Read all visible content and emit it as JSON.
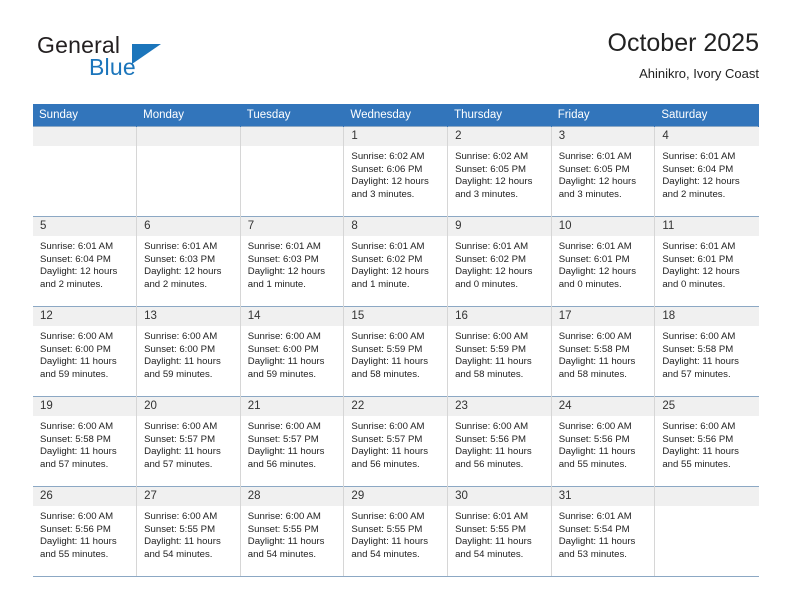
{
  "brand": {
    "word_one": "General",
    "word_two": "Blue",
    "triangle_icon": "triangle-logo-icon",
    "color_primary": "#1b75bb",
    "color_text": "#231f20"
  },
  "header": {
    "title": "October 2025",
    "subtitle": "Ahinikro, Ivory Coast"
  },
  "calendar": {
    "header_background": "#3275bb",
    "daynum_background": "#f0f0f0",
    "weekday_headers": [
      "Sunday",
      "Monday",
      "Tuesday",
      "Wednesday",
      "Thursday",
      "Friday",
      "Saturday"
    ],
    "weeks": [
      [
        {
          "day": "",
          "empty": true,
          "sunrise": "",
          "sunset": "",
          "daylight_1": "",
          "daylight_2": ""
        },
        {
          "day": "",
          "empty": true,
          "sunrise": "",
          "sunset": "",
          "daylight_1": "",
          "daylight_2": ""
        },
        {
          "day": "",
          "empty": true,
          "sunrise": "",
          "sunset": "",
          "daylight_1": "",
          "daylight_2": ""
        },
        {
          "day": "1",
          "empty": false,
          "sunrise": "Sunrise: 6:02 AM",
          "sunset": "Sunset: 6:06 PM",
          "daylight_1": "Daylight: 12 hours",
          "daylight_2": "and 3 minutes."
        },
        {
          "day": "2",
          "empty": false,
          "sunrise": "Sunrise: 6:02 AM",
          "sunset": "Sunset: 6:05 PM",
          "daylight_1": "Daylight: 12 hours",
          "daylight_2": "and 3 minutes."
        },
        {
          "day": "3",
          "empty": false,
          "sunrise": "Sunrise: 6:01 AM",
          "sunset": "Sunset: 6:05 PM",
          "daylight_1": "Daylight: 12 hours",
          "daylight_2": "and 3 minutes."
        },
        {
          "day": "4",
          "empty": false,
          "sunrise": "Sunrise: 6:01 AM",
          "sunset": "Sunset: 6:04 PM",
          "daylight_1": "Daylight: 12 hours",
          "daylight_2": "and 2 minutes."
        }
      ],
      [
        {
          "day": "5",
          "empty": false,
          "sunrise": "Sunrise: 6:01 AM",
          "sunset": "Sunset: 6:04 PM",
          "daylight_1": "Daylight: 12 hours",
          "daylight_2": "and 2 minutes."
        },
        {
          "day": "6",
          "empty": false,
          "sunrise": "Sunrise: 6:01 AM",
          "sunset": "Sunset: 6:03 PM",
          "daylight_1": "Daylight: 12 hours",
          "daylight_2": "and 2 minutes."
        },
        {
          "day": "7",
          "empty": false,
          "sunrise": "Sunrise: 6:01 AM",
          "sunset": "Sunset: 6:03 PM",
          "daylight_1": "Daylight: 12 hours",
          "daylight_2": "and 1 minute."
        },
        {
          "day": "8",
          "empty": false,
          "sunrise": "Sunrise: 6:01 AM",
          "sunset": "Sunset: 6:02 PM",
          "daylight_1": "Daylight: 12 hours",
          "daylight_2": "and 1 minute."
        },
        {
          "day": "9",
          "empty": false,
          "sunrise": "Sunrise: 6:01 AM",
          "sunset": "Sunset: 6:02 PM",
          "daylight_1": "Daylight: 12 hours",
          "daylight_2": "and 0 minutes."
        },
        {
          "day": "10",
          "empty": false,
          "sunrise": "Sunrise: 6:01 AM",
          "sunset": "Sunset: 6:01 PM",
          "daylight_1": "Daylight: 12 hours",
          "daylight_2": "and 0 minutes."
        },
        {
          "day": "11",
          "empty": false,
          "sunrise": "Sunrise: 6:01 AM",
          "sunset": "Sunset: 6:01 PM",
          "daylight_1": "Daylight: 12 hours",
          "daylight_2": "and 0 minutes."
        }
      ],
      [
        {
          "day": "12",
          "empty": false,
          "sunrise": "Sunrise: 6:00 AM",
          "sunset": "Sunset: 6:00 PM",
          "daylight_1": "Daylight: 11 hours",
          "daylight_2": "and 59 minutes."
        },
        {
          "day": "13",
          "empty": false,
          "sunrise": "Sunrise: 6:00 AM",
          "sunset": "Sunset: 6:00 PM",
          "daylight_1": "Daylight: 11 hours",
          "daylight_2": "and 59 minutes."
        },
        {
          "day": "14",
          "empty": false,
          "sunrise": "Sunrise: 6:00 AM",
          "sunset": "Sunset: 6:00 PM",
          "daylight_1": "Daylight: 11 hours",
          "daylight_2": "and 59 minutes."
        },
        {
          "day": "15",
          "empty": false,
          "sunrise": "Sunrise: 6:00 AM",
          "sunset": "Sunset: 5:59 PM",
          "daylight_1": "Daylight: 11 hours",
          "daylight_2": "and 58 minutes."
        },
        {
          "day": "16",
          "empty": false,
          "sunrise": "Sunrise: 6:00 AM",
          "sunset": "Sunset: 5:59 PM",
          "daylight_1": "Daylight: 11 hours",
          "daylight_2": "and 58 minutes."
        },
        {
          "day": "17",
          "empty": false,
          "sunrise": "Sunrise: 6:00 AM",
          "sunset": "Sunset: 5:58 PM",
          "daylight_1": "Daylight: 11 hours",
          "daylight_2": "and 58 minutes."
        },
        {
          "day": "18",
          "empty": false,
          "sunrise": "Sunrise: 6:00 AM",
          "sunset": "Sunset: 5:58 PM",
          "daylight_1": "Daylight: 11 hours",
          "daylight_2": "and 57 minutes."
        }
      ],
      [
        {
          "day": "19",
          "empty": false,
          "sunrise": "Sunrise: 6:00 AM",
          "sunset": "Sunset: 5:58 PM",
          "daylight_1": "Daylight: 11 hours",
          "daylight_2": "and 57 minutes."
        },
        {
          "day": "20",
          "empty": false,
          "sunrise": "Sunrise: 6:00 AM",
          "sunset": "Sunset: 5:57 PM",
          "daylight_1": "Daylight: 11 hours",
          "daylight_2": "and 57 minutes."
        },
        {
          "day": "21",
          "empty": false,
          "sunrise": "Sunrise: 6:00 AM",
          "sunset": "Sunset: 5:57 PM",
          "daylight_1": "Daylight: 11 hours",
          "daylight_2": "and 56 minutes."
        },
        {
          "day": "22",
          "empty": false,
          "sunrise": "Sunrise: 6:00 AM",
          "sunset": "Sunset: 5:57 PM",
          "daylight_1": "Daylight: 11 hours",
          "daylight_2": "and 56 minutes."
        },
        {
          "day": "23",
          "empty": false,
          "sunrise": "Sunrise: 6:00 AM",
          "sunset": "Sunset: 5:56 PM",
          "daylight_1": "Daylight: 11 hours",
          "daylight_2": "and 56 minutes."
        },
        {
          "day": "24",
          "empty": false,
          "sunrise": "Sunrise: 6:00 AM",
          "sunset": "Sunset: 5:56 PM",
          "daylight_1": "Daylight: 11 hours",
          "daylight_2": "and 55 minutes."
        },
        {
          "day": "25",
          "empty": false,
          "sunrise": "Sunrise: 6:00 AM",
          "sunset": "Sunset: 5:56 PM",
          "daylight_1": "Daylight: 11 hours",
          "daylight_2": "and 55 minutes."
        }
      ],
      [
        {
          "day": "26",
          "empty": false,
          "sunrise": "Sunrise: 6:00 AM",
          "sunset": "Sunset: 5:56 PM",
          "daylight_1": "Daylight: 11 hours",
          "daylight_2": "and 55 minutes."
        },
        {
          "day": "27",
          "empty": false,
          "sunrise": "Sunrise: 6:00 AM",
          "sunset": "Sunset: 5:55 PM",
          "daylight_1": "Daylight: 11 hours",
          "daylight_2": "and 54 minutes."
        },
        {
          "day": "28",
          "empty": false,
          "sunrise": "Sunrise: 6:00 AM",
          "sunset": "Sunset: 5:55 PM",
          "daylight_1": "Daylight: 11 hours",
          "daylight_2": "and 54 minutes."
        },
        {
          "day": "29",
          "empty": false,
          "sunrise": "Sunrise: 6:00 AM",
          "sunset": "Sunset: 5:55 PM",
          "daylight_1": "Daylight: 11 hours",
          "daylight_2": "and 54 minutes."
        },
        {
          "day": "30",
          "empty": false,
          "sunrise": "Sunrise: 6:01 AM",
          "sunset": "Sunset: 5:55 PM",
          "daylight_1": "Daylight: 11 hours",
          "daylight_2": "and 54 minutes."
        },
        {
          "day": "31",
          "empty": false,
          "sunrise": "Sunrise: 6:01 AM",
          "sunset": "Sunset: 5:54 PM",
          "daylight_1": "Daylight: 11 hours",
          "daylight_2": "and 53 minutes."
        },
        {
          "day": "",
          "empty": true,
          "sunrise": "",
          "sunset": "",
          "daylight_1": "",
          "daylight_2": ""
        }
      ]
    ]
  }
}
